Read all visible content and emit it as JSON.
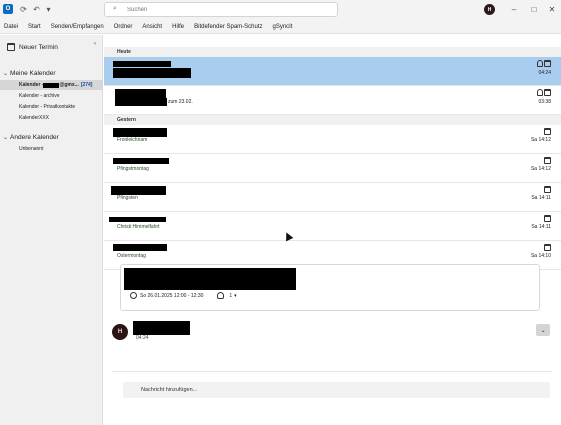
{
  "titlebar": {
    "app_logo": "O",
    "search_placeholder": "Suchen",
    "avatar_initial": "H",
    "icons": [
      "sync-icon",
      "undo-icon",
      "dropdown-icon"
    ]
  },
  "menu": [
    "Datei",
    "Start",
    "Senden/Empfangen",
    "Ordner",
    "Ansicht",
    "Hilfe",
    "Bitdefender Spam-Schutz",
    "gSyncIt"
  ],
  "sidebar": {
    "new_appointment": "Neuer Termin",
    "my_calendars_heading": "Meine Kalender",
    "my_calendars": [
      {
        "label": "Kalender - ",
        "suffix": "@gmx...",
        "count": "[274]",
        "selected": true
      },
      {
        "label": "Kalender - archive"
      },
      {
        "label": "Kalender - Privatkontakte"
      },
      {
        "label": "KalenderXXX"
      }
    ],
    "other_calendars_heading": "Andere Kalender",
    "other_calendars": [
      {
        "label": "Unbenannt"
      }
    ]
  },
  "list": {
    "today_heading": "Heute",
    "yesterday_heading": "Gestern",
    "today_items": [
      {
        "subject": "",
        "time": "04:24",
        "selected": true
      },
      {
        "subject": "",
        "detail": "zum 23.02.",
        "time": "03:38"
      }
    ],
    "yesterday_items": [
      {
        "subject": "Fronleichnam",
        "time": "Sa 14:12"
      },
      {
        "subject": "Pfingstmontag",
        "time": "Sa 14:12"
      },
      {
        "subject": "Pfingsten",
        "time": "Sa 14:11"
      },
      {
        "subject": "Christi Himmelfahrt",
        "time": "Sa 14:11"
      },
      {
        "subject": "Ostermontag",
        "time": "Sa 14:10"
      }
    ]
  },
  "reading": {
    "meeting_time": "So 26.01.2025 12:00 - 12:30",
    "attendees": "1",
    "sender_initial": "H",
    "sender_time": "04:24",
    "reply_placeholder": "Nachricht hinzufügen..."
  },
  "colors": {
    "selected_row": "#a8cdee",
    "accent": "#0f6cbd",
    "sidebar_bg": "#f0f0f0"
  }
}
